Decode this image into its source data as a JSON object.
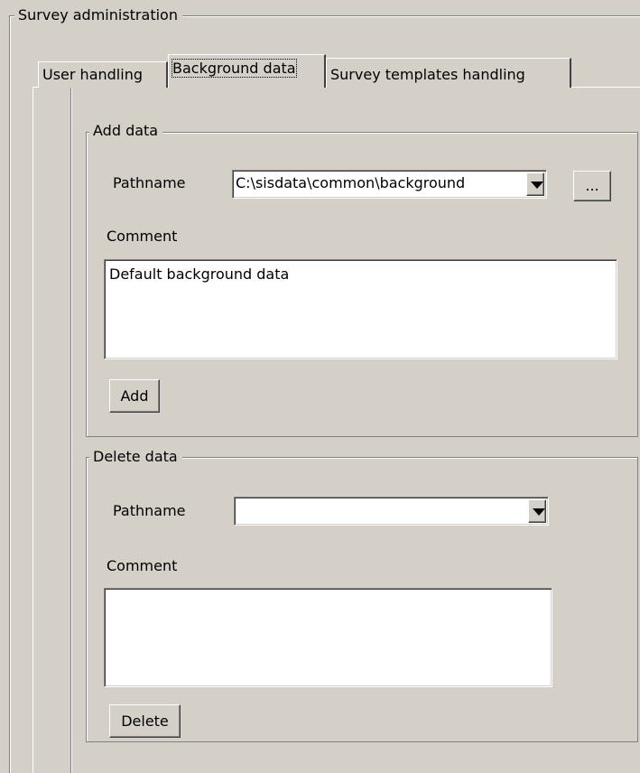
{
  "group": {
    "title": "Survey administration"
  },
  "tabs": [
    {
      "label": "User handling",
      "active": false
    },
    {
      "label": "Background data",
      "active": true
    },
    {
      "label": "Survey templates handling",
      "active": false
    }
  ],
  "add_data": {
    "title": "Add data",
    "pathname_label": "Pathname",
    "pathname_value": "C:\\sisdata\\common\\background",
    "browse_label": "...",
    "comment_label": "Comment",
    "comment_value": "Default background data",
    "add_button": "Add"
  },
  "delete_data": {
    "title": "Delete data",
    "pathname_label": "Pathname",
    "pathname_value": "",
    "comment_label": "Comment",
    "comment_value": "",
    "delete_button": "Delete"
  },
  "icons": {
    "dropdown": "chevron-down-icon"
  }
}
